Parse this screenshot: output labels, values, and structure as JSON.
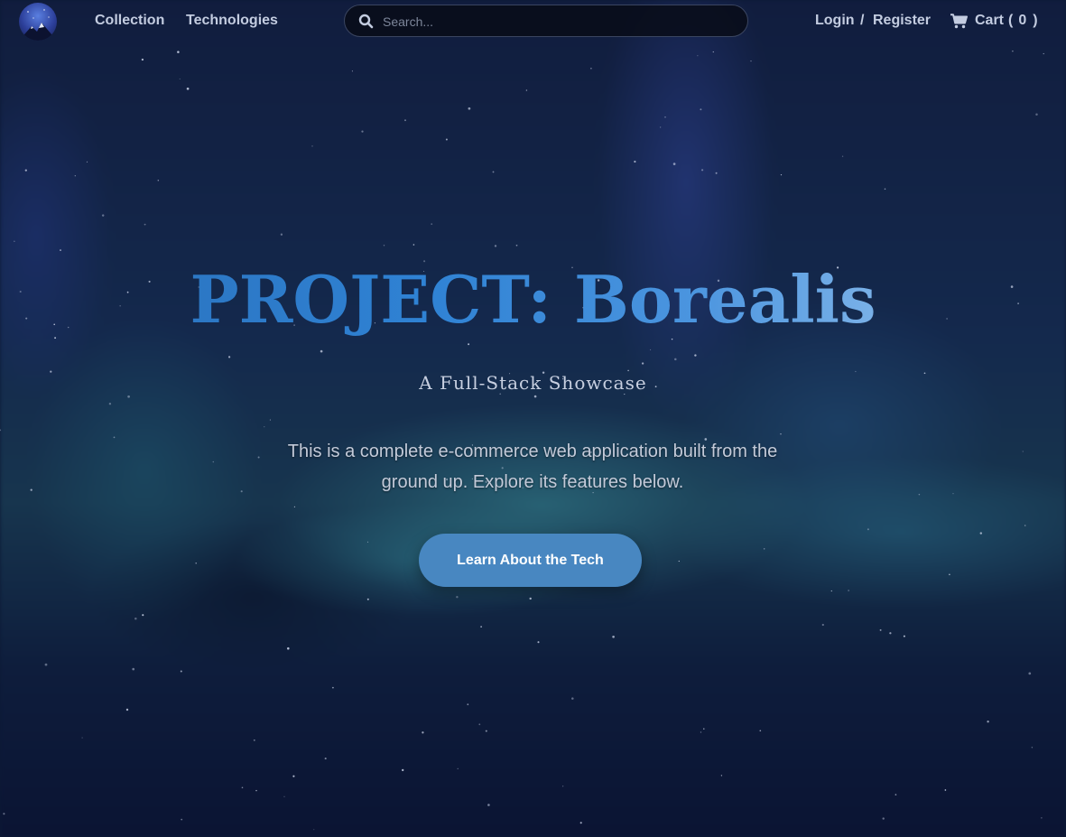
{
  "nav": {
    "links": [
      {
        "label": "Collection"
      },
      {
        "label": "Technologies"
      }
    ],
    "search": {
      "placeholder": "Search..."
    },
    "auth": {
      "login": "Login",
      "separator": "/",
      "register": "Register"
    },
    "cart": {
      "label": "Cart",
      "open": "(",
      "count": "0",
      "close": ")"
    }
  },
  "hero": {
    "title": "PROJECT: Borealis",
    "subtitle": "A Full-Stack Showcase",
    "description": "This is a complete e-commerce web application built from the ground up. Explore its features below.",
    "cta_label": "Learn About the Tech"
  },
  "colors": {
    "background": "#0d1a36",
    "accent": "#4887c1",
    "title_start": "#2a6fb8",
    "title_end": "#a9cdf1",
    "nav_text": "#c3cce0"
  },
  "icons": {
    "logo": "mountain-aurora-logo",
    "search": "search-icon",
    "cart": "cart-icon"
  }
}
